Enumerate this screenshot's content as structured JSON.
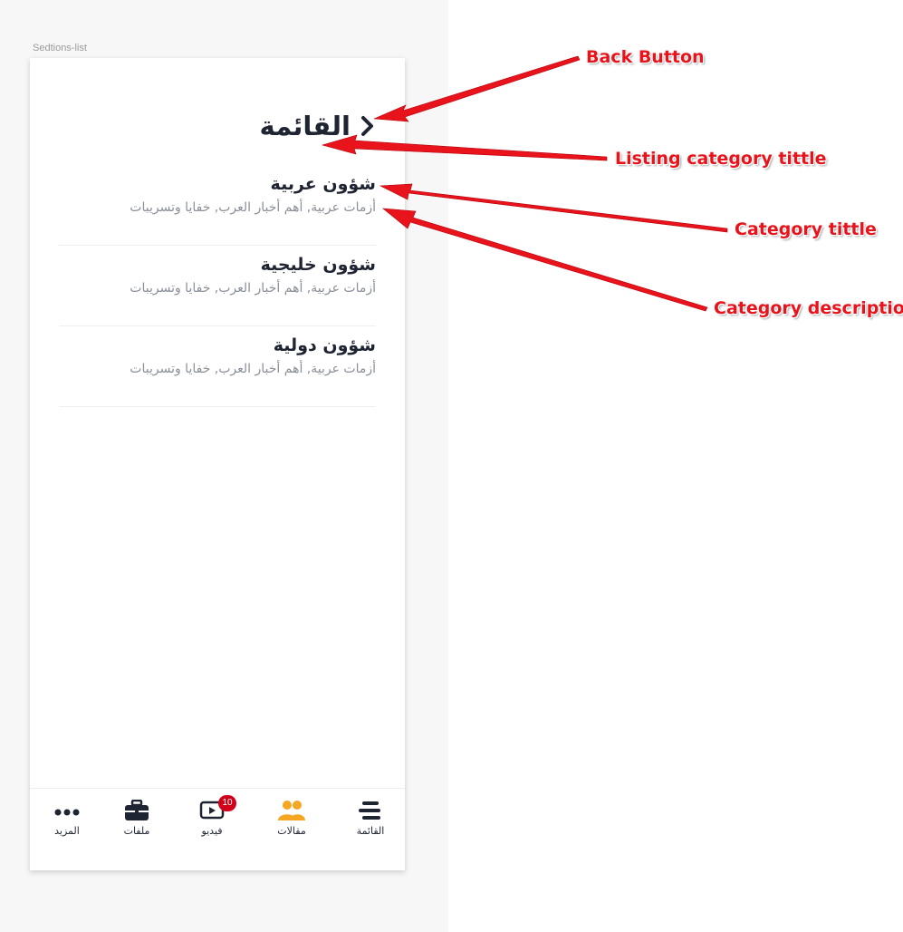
{
  "frame_label": "Sedtions-list",
  "header": {
    "title": "القائمة",
    "back_icon": "chevron-right-icon"
  },
  "categories": [
    {
      "title": "شؤون عربية",
      "description": "أزمات عربية, أهم أخبار العرب, خفايا وتسريبات"
    },
    {
      "title": "شؤون خليجية",
      "description": "أزمات عربية, أهم أخبار العرب, خفايا وتسريبات"
    },
    {
      "title": "شؤون دولية",
      "description": "أزمات عربية, أهم أخبار العرب, خفايا وتسريبات"
    }
  ],
  "tabbar": {
    "items": [
      {
        "label": "القائمة",
        "icon": "menu-lines-icon"
      },
      {
        "label": "مقالات",
        "icon": "people-icon",
        "color": "#f5a623"
      },
      {
        "label": "فيديو",
        "icon": "video-play-icon",
        "badge": "10"
      },
      {
        "label": "ملفات",
        "icon": "briefcase-icon"
      },
      {
        "label": "المزيد",
        "icon": "more-dots-icon"
      }
    ]
  },
  "annotations": {
    "back_button": "Back Button",
    "listing_title": "Listing category tittle",
    "category_title": "Category tittle",
    "category_description": "Category description"
  },
  "colors": {
    "text_dark": "#1f2432",
    "text_muted": "#8a8f99",
    "accent_orange": "#f5a623",
    "badge_red": "#d0021b",
    "annotation_red": "#e8131b"
  }
}
